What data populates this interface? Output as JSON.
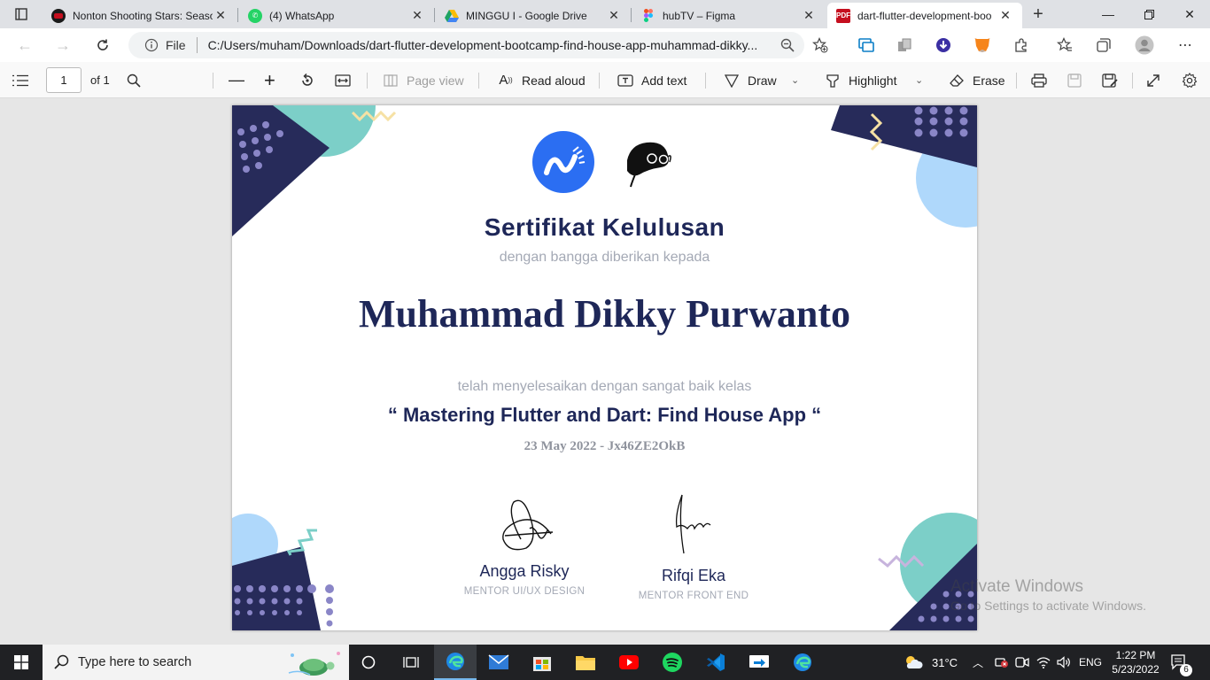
{
  "browser": {
    "tabs": [
      {
        "title": "Nonton Shooting Stars: Season",
        "icon": "rec-icon",
        "color": "#c50f1f"
      },
      {
        "title": "(4) WhatsApp",
        "icon": "whatsapp-icon",
        "color": "#25d366"
      },
      {
        "title": "MINGGU I - Google Drive",
        "icon": "google-drive-icon",
        "color": "#1fa463"
      },
      {
        "title": "hubTV – Figma",
        "icon": "figma-icon",
        "color": "#f24e1e"
      },
      {
        "title": "dart-flutter-development-boo",
        "icon": "pdf-icon",
        "color": "#c50f1f"
      }
    ],
    "address": {
      "file_label": "File",
      "url": "C:/Users/muham/Downloads/dart-flutter-development-bootcamp-find-house-app-muhammad-dikky..."
    }
  },
  "pdf_toolbar": {
    "page_current": "1",
    "page_total": "of 1",
    "page_view": "Page view",
    "read_aloud": "Read aloud",
    "add_text": "Add text",
    "draw": "Draw",
    "highlight": "Highlight",
    "erase": "Erase"
  },
  "certificate": {
    "title": "Sertifikat Kelulusan",
    "subtitle": "dengan bangga diberikan kepada",
    "recipient": "Muhammad Dikky Purwanto",
    "completion_text": "telah menyelesaikan dengan sangat baik kelas",
    "course": "“ Mastering Flutter and Dart: Find House App  “",
    "meta": "23 May 2022 - Jx46ZE2OkB",
    "signatories": [
      {
        "name": "Angga Risky",
        "role": "MENTOR UI/UX DESIGN"
      },
      {
        "name": "Rifqi Eka",
        "role": "MENTOR FRONT END"
      }
    ],
    "colors": {
      "navy": "#272b5a",
      "teal": "#7ccfc8",
      "sky": "#afd8fb",
      "purple": "#8a86c7",
      "yellow": "#f6e1a4",
      "brand_blue": "#2b6ef2"
    }
  },
  "watermark": {
    "title": "Activate Windows",
    "subtitle": "Go to Settings to activate Windows."
  },
  "taskbar": {
    "search_placeholder": "Type here to search",
    "weather": "31°C",
    "language": "ENG",
    "time": "1:22 PM",
    "date": "5/23/2022",
    "notifications": "6"
  }
}
